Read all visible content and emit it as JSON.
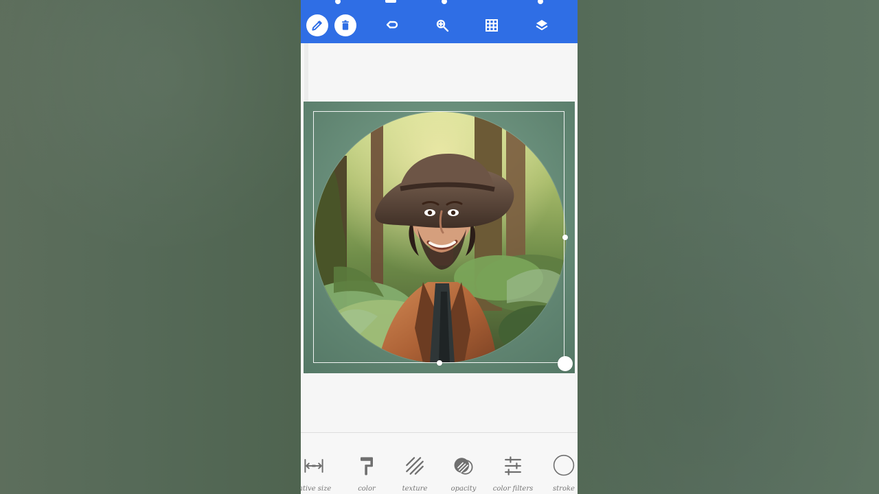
{
  "toolbar": {
    "tools": [
      {
        "name": "edit-icon"
      },
      {
        "name": "trash-icon"
      },
      {
        "name": "undo-icon"
      },
      {
        "name": "zoom-in-icon"
      },
      {
        "name": "grid-icon"
      },
      {
        "name": "layers-icon"
      }
    ],
    "accent": "#2f6ee5"
  },
  "canvas": {
    "background_color": "#6f9581",
    "selection_color": "#ffffff"
  },
  "bottom_tools": {
    "items": [
      {
        "label": "lative size",
        "icon": "relative-size-icon"
      },
      {
        "label": "color",
        "icon": "paint-roller-icon"
      },
      {
        "label": "texture",
        "icon": "texture-icon"
      },
      {
        "label": "opacity",
        "icon": "opacity-icon"
      },
      {
        "label": "color filters",
        "icon": "color-filters-icon"
      },
      {
        "label": "stroke",
        "icon": "stroke-icon"
      }
    ]
  }
}
